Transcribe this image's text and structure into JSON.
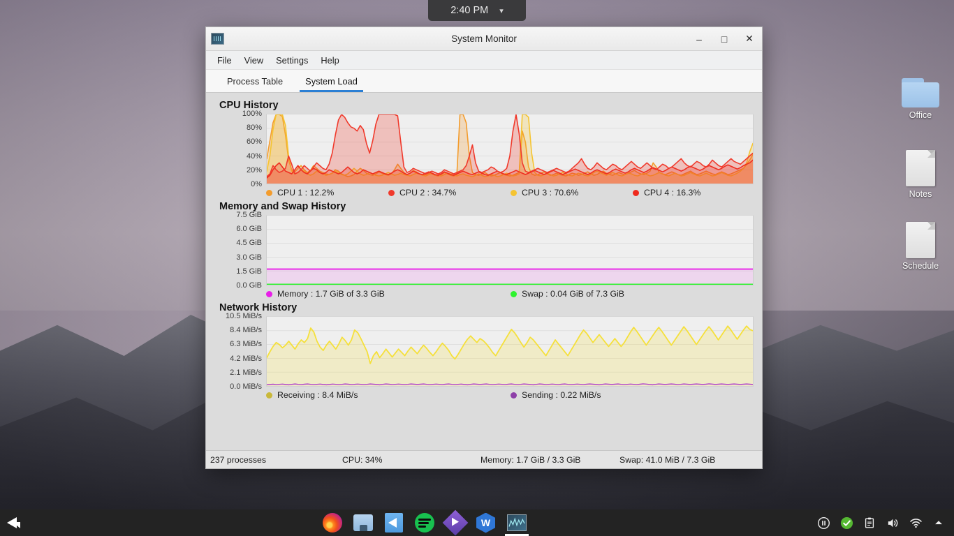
{
  "desktop": {
    "clock": {
      "time": "2:40 PM",
      "chevron": "chevron-down-icon"
    },
    "icons": [
      {
        "label": "Office",
        "type": "folder"
      },
      {
        "label": "Notes",
        "type": "document"
      },
      {
        "label": "Schedule",
        "type": "document"
      }
    ]
  },
  "window": {
    "title": "System Monitor",
    "controls": {
      "minimize": "–",
      "maximize": "□",
      "close": "✕"
    },
    "menu": [
      "File",
      "View",
      "Settings",
      "Help"
    ],
    "tabs": [
      {
        "label": "Process Table",
        "active": false
      },
      {
        "label": "System Load",
        "active": true
      }
    ],
    "statusbar": {
      "processes": "237 processes",
      "cpu": "CPU: 34%",
      "memory": "Memory: 1.7 GiB / 3.3 GiB",
      "swap": "Swap: 41.0 MiB / 7.3 GiB"
    }
  },
  "sections": {
    "cpu": {
      "title": "CPU History"
    },
    "memory": {
      "title": "Memory and Swap History"
    },
    "network": {
      "title": "Network History"
    }
  },
  "chart_data": [
    {
      "type": "area",
      "title": "CPU History",
      "ylabel": "",
      "xlabel": "",
      "ylim": [
        0,
        100
      ],
      "yticks": [
        "0%",
        "20%",
        "40%",
        "60%",
        "80%",
        "100%"
      ],
      "grid": true,
      "legend_position": "bottom",
      "series": [
        {
          "name": "CPU 1",
          "label": "CPU 1 : 12.2%",
          "current": 12.2,
          "color": "#f39c2d",
          "values": [
            36,
            62,
            88,
            100,
            100,
            97,
            70,
            34,
            20,
            17,
            22,
            26,
            20,
            16,
            19,
            26,
            22,
            18,
            16,
            14,
            13,
            15,
            20,
            18,
            14,
            12,
            10,
            11,
            13,
            18,
            22,
            19,
            15,
            13,
            12,
            14,
            17,
            15,
            13,
            12,
            14,
            20,
            28,
            22,
            16,
            13,
            15,
            19,
            17,
            14,
            12,
            13,
            15,
            14,
            12,
            11,
            13,
            16,
            14,
            12,
            11,
            13,
            100,
            100,
            88,
            40,
            16,
            13,
            12,
            14,
            16,
            13,
            11,
            12,
            14,
            16,
            13,
            12,
            11,
            12,
            14,
            16,
            76,
            60,
            24,
            14,
            12,
            13,
            15,
            17,
            14,
            12,
            13,
            15,
            13,
            12,
            11,
            13,
            15,
            14,
            12,
            13,
            15,
            17,
            14,
            12,
            13,
            16,
            18,
            15,
            13,
            12,
            14,
            16,
            14,
            13,
            15,
            17,
            19,
            16,
            14,
            13,
            15,
            18,
            30,
            24,
            16,
            14,
            13,
            15,
            17,
            15,
            13,
            12,
            14,
            16,
            18,
            15,
            13,
            14,
            16,
            18,
            16,
            14,
            13,
            15,
            17,
            15,
            13,
            14,
            16,
            18,
            20,
            22,
            28,
            34,
            42
          ]
        },
        {
          "name": "CPU 2",
          "label": "CPU 2 : 34.7%",
          "current": 34.7,
          "color": "#f0392b",
          "values": [
            10,
            14,
            26,
            20,
            16,
            18,
            22,
            40,
            28,
            14,
            16,
            20,
            26,
            22,
            18,
            24,
            30,
            26,
            22,
            20,
            28,
            44,
            70,
            92,
            100,
            96,
            88,
            82,
            80,
            76,
            84,
            78,
            58,
            44,
            62,
            86,
            100,
            100,
            100,
            100,
            100,
            100,
            98,
            60,
            24,
            16,
            18,
            22,
            20,
            18,
            16,
            14,
            16,
            18,
            16,
            14,
            16,
            20,
            18,
            16,
            14,
            16,
            18,
            20,
            26,
            40,
            56,
            30,
            18,
            16,
            18,
            20,
            24,
            22,
            18,
            16,
            18,
            22,
            40,
            76,
            100,
            72,
            30,
            18,
            16,
            18,
            20,
            22,
            20,
            18,
            16,
            18,
            20,
            22,
            20,
            18,
            16,
            18,
            22,
            26,
            30,
            36,
            28,
            22,
            20,
            24,
            30,
            26,
            22,
            20,
            24,
            28,
            26,
            22,
            20,
            24,
            28,
            32,
            28,
            24,
            22,
            26,
            30,
            26,
            22,
            20,
            24,
            28,
            26,
            22,
            24,
            28,
            32,
            36,
            30,
            26,
            24,
            28,
            32,
            30,
            26,
            24,
            28,
            34,
            30,
            26,
            24,
            28,
            32,
            36,
            32,
            30,
            28,
            32,
            36,
            40,
            44
          ]
        },
        {
          "name": "CPU 3",
          "label": "CPU 3 : 70.6%",
          "current": 70.6,
          "color": "#f5c431",
          "values": [
            18,
            40,
            78,
            100,
            100,
            100,
            84,
            40,
            18,
            14,
            16,
            20,
            18,
            14,
            12,
            14,
            18,
            16,
            14,
            12,
            13,
            15,
            18,
            16,
            13,
            12,
            14,
            18,
            22,
            18,
            14,
            12,
            13,
            16,
            14,
            12,
            11,
            12,
            14,
            16,
            14,
            12,
            13,
            15,
            13,
            12,
            11,
            13,
            15,
            14,
            12,
            11,
            13,
            15,
            13,
            12,
            11,
            13,
            15,
            14,
            12,
            11,
            13,
            14,
            12,
            11,
            10,
            12,
            14,
            12,
            10,
            11,
            13,
            12,
            10,
            11,
            13,
            15,
            13,
            11,
            12,
            14,
            100,
            100,
            96,
            44,
            16,
            12,
            11,
            13,
            15,
            13,
            11,
            12,
            14,
            16,
            14,
            12,
            11,
            13,
            15,
            14,
            12,
            11,
            13,
            16,
            18,
            16,
            14,
            12,
            14,
            16,
            14,
            12,
            11,
            13,
            15,
            14,
            12,
            11,
            13,
            15,
            13,
            11,
            12,
            14,
            16,
            14,
            12,
            11,
            13,
            15,
            13,
            11,
            12,
            14,
            16,
            14,
            12,
            11,
            13,
            15,
            13,
            11,
            12,
            14,
            16,
            14,
            12,
            11,
            13,
            15,
            18,
            22,
            30,
            46,
            58
          ]
        },
        {
          "name": "CPU 4",
          "label": "CPU 4 : 16.3%",
          "current": 16.3,
          "color": "#ef2a1d",
          "values": [
            8,
            12,
            20,
            26,
            30,
            24,
            18,
            16,
            14,
            20,
            26,
            20,
            16,
            14,
            18,
            22,
            20,
            16,
            14,
            16,
            20,
            18,
            16,
            14,
            16,
            20,
            24,
            20,
            16,
            14,
            16,
            20,
            18,
            16,
            14,
            16,
            18,
            16,
            14,
            13,
            15,
            18,
            20,
            18,
            15,
            13,
            15,
            18,
            16,
            14,
            13,
            15,
            17,
            15,
            13,
            12,
            14,
            17,
            15,
            13,
            12,
            14,
            16,
            18,
            16,
            14,
            13,
            15,
            17,
            15,
            13,
            12,
            14,
            16,
            18,
            16,
            14,
            13,
            15,
            17,
            19,
            17,
            15,
            13,
            15,
            17,
            19,
            17,
            15,
            13,
            15,
            17,
            19,
            17,
            15,
            13,
            15,
            17,
            19,
            21,
            19,
            17,
            15,
            13,
            15,
            18,
            20,
            18,
            16,
            14,
            16,
            19,
            21,
            19,
            17,
            15,
            17,
            20,
            22,
            20,
            18,
            16,
            18,
            21,
            23,
            21,
            19,
            17,
            19,
            22,
            24,
            22,
            20,
            18,
            20,
            23,
            25,
            23,
            21,
            19,
            21,
            24,
            26,
            24,
            22,
            20,
            22,
            25,
            27,
            25,
            23,
            21,
            23,
            26,
            28,
            30,
            34
          ]
        }
      ]
    },
    {
      "type": "area",
      "title": "Memory and Swap History",
      "ylim": [
        0,
        7.5
      ],
      "yticks": [
        "0.0 GiB",
        "1.5 GiB",
        "3.0 GiB",
        "4.5 GiB",
        "6.0 GiB",
        "7.5 GiB"
      ],
      "grid": true,
      "legend_position": "bottom",
      "series": [
        {
          "name": "Memory",
          "label": "Memory : 1.7 GiB of 3.3 GiB",
          "current": 1.7,
          "total": 3.3,
          "color": "#e81ee8",
          "flat_value": 1.7
        },
        {
          "name": "Swap",
          "label": "Swap : 0.04 GiB of 7.3 GiB",
          "current": 0.04,
          "total": 7.3,
          "color": "#2ef32e",
          "flat_value": 0.04
        }
      ]
    },
    {
      "type": "line",
      "title": "Network History",
      "ylim": [
        0,
        10.5
      ],
      "yticks": [
        "0.0 MiB/s",
        "2.1 MiB/s",
        "4.2 MiB/s",
        "6.3 MiB/s",
        "8.4 MiB/s",
        "10.5 MiB/s"
      ],
      "grid": true,
      "legend_position": "bottom",
      "series": [
        {
          "name": "Receiving",
          "label": "Receiving : 8.4 MiB/s",
          "current": 8.4,
          "color": "#f5e03a",
          "values": [
            4.3,
            5.2,
            6.0,
            6.6,
            6.3,
            5.8,
            6.2,
            6.8,
            6.2,
            5.6,
            6.4,
            7.0,
            6.6,
            7.2,
            8.8,
            8.2,
            6.8,
            5.9,
            5.4,
            6.2,
            6.8,
            6.2,
            5.6,
            6.4,
            7.4,
            6.9,
            6.2,
            7.0,
            8.5,
            8.1,
            7.2,
            6.2,
            5.2,
            3.4,
            4.6,
            5.2,
            4.3,
            4.9,
            5.6,
            5.0,
            4.4,
            5.0,
            5.6,
            5.1,
            4.6,
            5.3,
            5.9,
            5.4,
            4.9,
            5.6,
            6.2,
            5.7,
            5.1,
            4.6,
            5.2,
            5.9,
            6.5,
            6.0,
            5.4,
            4.6,
            4.1,
            4.8,
            5.6,
            6.4,
            7.1,
            7.6,
            7.1,
            6.6,
            7.2,
            6.9,
            6.4,
            5.8,
            5.1,
            4.6,
            5.4,
            6.2,
            7.0,
            7.8,
            8.6,
            8.1,
            7.4,
            6.6,
            5.9,
            6.6,
            7.4,
            7.0,
            6.4,
            5.8,
            5.2,
            4.6,
            5.4,
            6.2,
            7.0,
            6.4,
            5.8,
            5.2,
            4.6,
            5.4,
            6.2,
            7.0,
            7.8,
            8.5,
            8.0,
            7.3,
            6.6,
            7.2,
            7.8,
            7.2,
            6.6,
            6.0,
            6.6,
            7.2,
            6.6,
            6.0,
            6.6,
            7.4,
            8.2,
            8.9,
            8.3,
            7.6,
            6.9,
            6.2,
            6.9,
            7.6,
            8.3,
            8.9,
            8.3,
            7.6,
            6.9,
            6.2,
            6.9,
            7.6,
            8.3,
            9.0,
            8.4,
            7.7,
            7.0,
            6.3,
            7.0,
            7.7,
            8.4,
            9.0,
            8.4,
            7.7,
            7.0,
            7.7,
            8.4,
            9.1,
            8.5,
            7.8,
            7.1,
            7.8,
            8.5,
            9.1,
            8.6,
            8.4
          ]
        },
        {
          "name": "Sending",
          "label": "Sending : 0.22 MiB/s",
          "current": 0.22,
          "color": "#b44ecb",
          "values": [
            0.18,
            0.22,
            0.26,
            0.2,
            0.24,
            0.28,
            0.22,
            0.18,
            0.24,
            0.3,
            0.24,
            0.2,
            0.26,
            0.3,
            0.24,
            0.2,
            0.24,
            0.28,
            0.22,
            0.18,
            0.22,
            0.28,
            0.24,
            0.2,
            0.24,
            0.3,
            0.26,
            0.2,
            0.24,
            0.28,
            0.24,
            0.2,
            0.24,
            0.3,
            0.26,
            0.22,
            0.18,
            0.24,
            0.3,
            0.26,
            0.2,
            0.24,
            0.28,
            0.24,
            0.2,
            0.24,
            0.3,
            0.26,
            0.22,
            0.26,
            0.3,
            0.24,
            0.2,
            0.24,
            0.28,
            0.24,
            0.2,
            0.26,
            0.3,
            0.24,
            0.2,
            0.24,
            0.28,
            0.22,
            0.18,
            0.24,
            0.3,
            0.26,
            0.22,
            0.26,
            0.3,
            0.24,
            0.2,
            0.24,
            0.28,
            0.24,
            0.2,
            0.26,
            0.3,
            0.24,
            0.2,
            0.24,
            0.3,
            0.26,
            0.22,
            0.18,
            0.24,
            0.3,
            0.26,
            0.2,
            0.24,
            0.28,
            0.24,
            0.2,
            0.26,
            0.3,
            0.24,
            0.2,
            0.24,
            0.28,
            0.24,
            0.2,
            0.26,
            0.3,
            0.26,
            0.22,
            0.18,
            0.24,
            0.3,
            0.26,
            0.22,
            0.26,
            0.3,
            0.24,
            0.2,
            0.24,
            0.28,
            0.24,
            0.2,
            0.26,
            0.32,
            0.28,
            0.22,
            0.18,
            0.24,
            0.3,
            0.26,
            0.22,
            0.26,
            0.3,
            0.26,
            0.2,
            0.24,
            0.3,
            0.26,
            0.22,
            0.26,
            0.3,
            0.26,
            0.22,
            0.26,
            0.32,
            0.28,
            0.22,
            0.26,
            0.3,
            0.26,
            0.22,
            0.26,
            0.3,
            0.26,
            0.22,
            0.26,
            0.3,
            0.26,
            0.22
          ]
        }
      ]
    }
  ],
  "taskbar": {
    "launcher": "bird-launcher-icon",
    "apps": [
      {
        "name": "firefox",
        "active": false
      },
      {
        "name": "file-manager",
        "active": false
      },
      {
        "name": "blue-app",
        "active": false
      },
      {
        "name": "spotify",
        "active": false
      },
      {
        "name": "media-player",
        "active": false
      },
      {
        "name": "wps-office",
        "active": false,
        "glyph": "W"
      },
      {
        "name": "system-monitor",
        "active": true
      }
    ],
    "tray": [
      "pause-icon",
      "check-icon",
      "clipboard-icon",
      "volume-icon",
      "wifi-icon",
      "show-hidden-icon"
    ]
  }
}
